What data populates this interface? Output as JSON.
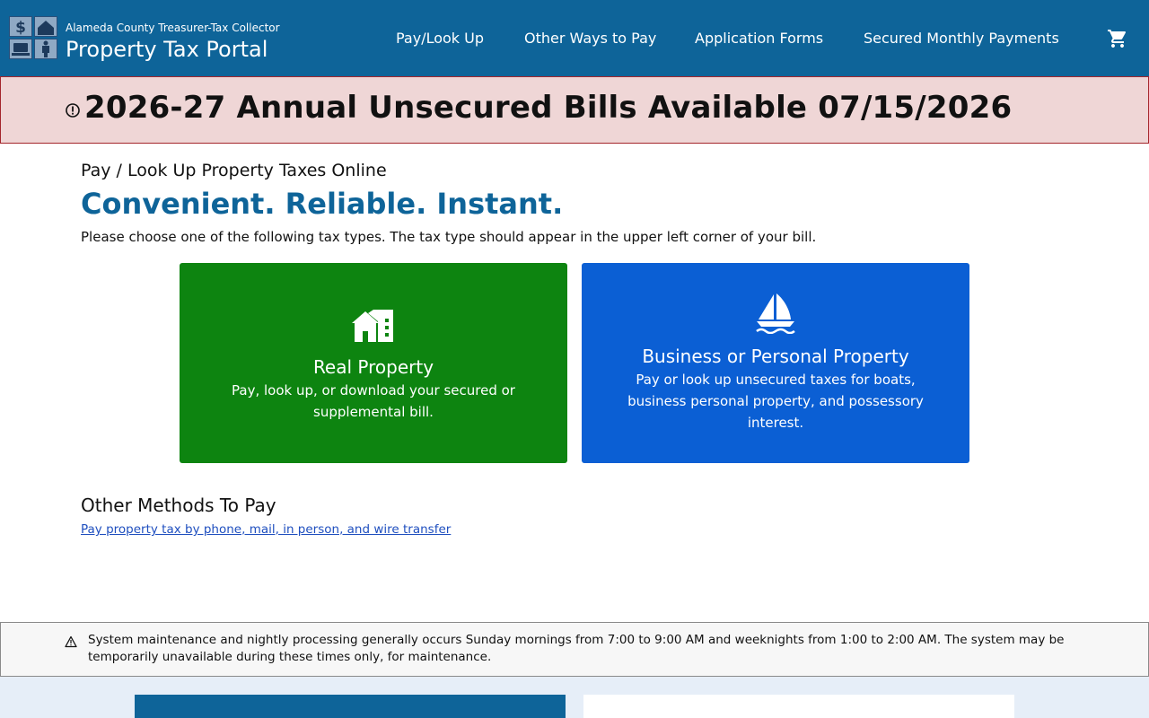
{
  "header": {
    "subtitle": "Alameda County Treasurer-Tax Collector",
    "title": "Property Tax Portal",
    "nav": [
      {
        "label": "Pay/Look Up"
      },
      {
        "label": "Other Ways to Pay"
      },
      {
        "label": "Application Forms"
      },
      {
        "label": "Secured Monthly Payments"
      }
    ],
    "cart_icon": "shopping-cart-icon"
  },
  "alert": {
    "icon": "alert-circle-icon",
    "text": "2026-27 Annual Unsecured Bills Available 07/15/2026"
  },
  "main": {
    "heading": "Pay / Look Up Property Taxes Online",
    "tagline": "Convenient. Reliable. Instant.",
    "instructions": "Please choose one of the following tax types. The tax type should appear in the upper left corner of your bill.",
    "cards": [
      {
        "icon": "house-icon",
        "title": "Real Property",
        "description": "Pay, look up, or download your secured or supplemental bill."
      },
      {
        "icon": "sailboat-icon",
        "title": "Business or Personal Property",
        "description": "Pay or look up unsecured taxes for boats, business personal property, and possessory interest."
      }
    ],
    "other_heading": "Other Methods To Pay",
    "other_link": "Pay property tax by phone, mail, in person, and wire transfer"
  },
  "notice": {
    "icon": "warning-triangle-icon",
    "text": "System maintenance and nightly processing generally occurs Sunday mornings from 7:00 to 9:00 AM and weeknights from 1:00 to 2:00 AM. The system may be temporarily unavailable during these times only, for maintenance."
  },
  "colors": {
    "header_bg": "#0e6499",
    "alert_bg": "#efd6d6",
    "alert_border": "#a4262c",
    "real_card": "#0d8410",
    "business_card": "#0b5fd4",
    "tagline": "#0e6499",
    "link": "#1f4fbf"
  }
}
